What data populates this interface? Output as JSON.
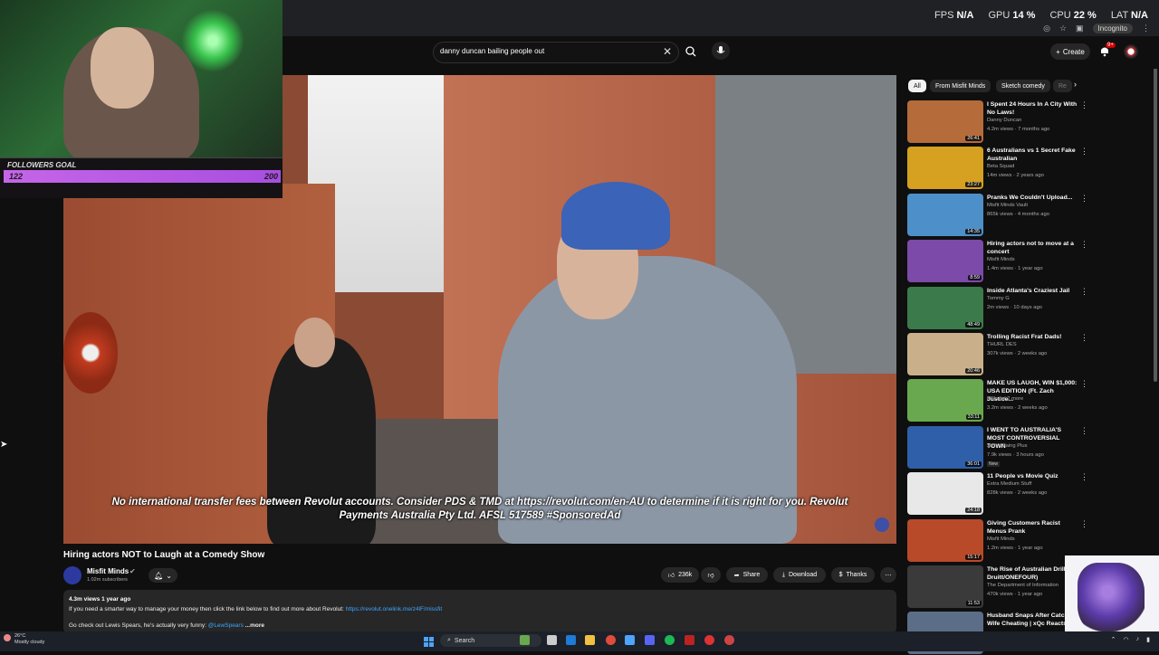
{
  "perf": {
    "fps_label": "FPS",
    "fps_val": "N/A",
    "gpu_label": "GPU",
    "gpu_val": "14 %",
    "cpu_label": "CPU",
    "cpu_val": "22 %",
    "lat_label": "LAT",
    "lat_val": "N/A"
  },
  "browser": {
    "incognito": "Incognito"
  },
  "search": {
    "query": "danny duncan bailing people out",
    "clear": "✕"
  },
  "header": {
    "create_label": "Create",
    "bell_badge": "9+"
  },
  "webcam": {
    "goal_title": "FOLLOWERS GOAL",
    "goal_current": "122",
    "goal_max": "200",
    "goal_progress": 0.61
  },
  "video": {
    "subtitle": "No international transfer fees between Revolut accounts. Consider PDS & TMD at https://revolut.com/en-AU  to determine if it is right for you. Revolut Payments Australia Pty Ltd. AFSL 517589 #SponsoredAd",
    "title": "Hiring actors NOT to Laugh at a Comedy Show",
    "channel": "Misfit Minds",
    "subscribers": "1.02m subscribers",
    "likes": "236k",
    "share_label": "Share",
    "download_label": "Download",
    "thanks_label": "Thanks",
    "views_age": "4.3m views  1 year ago",
    "desc_line1": "If you need a smarter way to manage your money then click the link below to find out more about Revolut:",
    "desc_link": "https://revolut.onelink.me/z4lF/missfit",
    "desc_line2_prefix": "Go check out Lewis Spears, he's actually very funny:",
    "desc_line2_handle": "@LewSpears",
    "desc_more": "...more"
  },
  "chips": {
    "all": "All",
    "misfit": "From Misfit Minds",
    "sketch": "Sketch comedy",
    "more": "Re"
  },
  "recommendations": [
    {
      "title": "I Spent 24 Hours In A City With No Laws!",
      "channel": "Danny Duncan",
      "meta": "4.2m views · 7 months ago",
      "duration": "26:41",
      "color": "#b56b3a"
    },
    {
      "title": "6 Australians vs 1 Secret Fake Australian",
      "channel": "Beta Squad",
      "meta": "14m views · 2 years ago",
      "duration": "23:27",
      "color": "#d6a020"
    },
    {
      "title": "Pranks We Couldn't Upload...",
      "channel": "Misfit Minds Vault",
      "meta": "865k views · 4 months ago",
      "duration": "14:35",
      "color": "#4d8fc9"
    },
    {
      "title": "Hiring actors not to move at a concert",
      "channel": "Misfit Minds",
      "meta": "1.4m views · 1 year ago",
      "duration": "8:59",
      "color": "#7c4aa8"
    },
    {
      "title": "Inside Atlanta's Craziest Jail",
      "channel": "Tommy G",
      "meta": "2m views · 10 days ago",
      "duration": "48:49",
      "color": "#3b7a4a"
    },
    {
      "title": "Trolling Racist Frat Dads!",
      "channel": "THURL DES",
      "meta": "307k views · 2 weeks ago",
      "duration": "20:46",
      "color": "#c9b08a"
    },
    {
      "title": "MAKE US LAUGH, WIN $1,000: USA EDITION (Ft. Zach Justice...",
      "channel": "KSI and 2 more",
      "meta": "3.2m views · 2 weeks ago",
      "duration": "33:11",
      "color": "#6aa84f"
    },
    {
      "title": "I WENT TO AUSTRALIA'S MOST CONTROVERSIAL TOWN",
      "channel": "Jaden Laing Plus",
      "meta": "7.9k views · 3 hours ago",
      "duration": "36:01",
      "new": "New",
      "color": "#2f5fa8"
    },
    {
      "title": "11 People vs Movie Quiz",
      "channel": "Extra Medium Stuff",
      "meta": "828k views · 2 weeks ago",
      "duration": "24:18",
      "color": "#e8e8e8"
    },
    {
      "title": "Giving Customers Racist Menus Prank",
      "channel": "Misfit Minds",
      "meta": "1.2m views · 1 year ago",
      "duration": "15:17",
      "color": "#b84a2a"
    },
    {
      "title": "The Rise of Australian Drill (Mt Druitt/ONEFOUR)",
      "channel": "The Department of Information",
      "meta": "470k views · 1 year ago",
      "duration": "11:53",
      "color": "#3a3a3a"
    },
    {
      "title": "Husband Snaps After Catch Wife Cheating | xQc Reacts",
      "channel": "",
      "meta": "",
      "duration": "",
      "color": "#5b6d87"
    }
  ],
  "taskbar": {
    "weather_temp": "26°C",
    "weather_desc": "Mostly cloudy",
    "search_label": "Search"
  }
}
